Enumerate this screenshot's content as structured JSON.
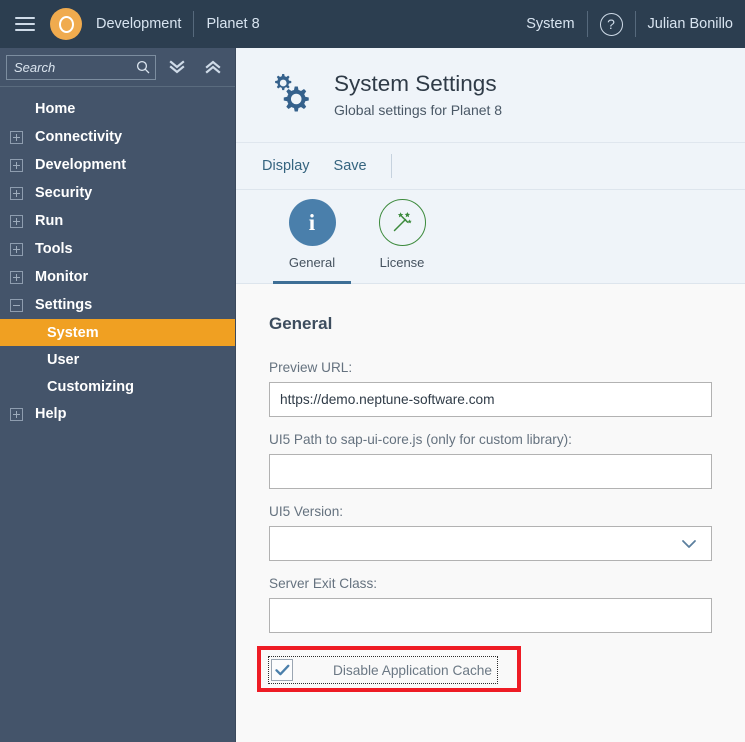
{
  "topbar": {
    "menu_icon": "hamburger-icon",
    "logo_icon": "neptune-logo-icon",
    "brand": "Development",
    "project": "Planet 8",
    "system_label": "System",
    "help_icon": "question-mark-icon",
    "user_name": "Julian Bonillo"
  },
  "sidebar": {
    "search": {
      "placeholder": "Search",
      "value": "",
      "icon": "search-icon"
    },
    "collapse_all_icon": "double-chevron-down-icon",
    "expand_all_icon": "double-chevron-up-icon",
    "items": [
      {
        "label": "Home",
        "twisty": "none"
      },
      {
        "label": "Connectivity",
        "twisty": "plus"
      },
      {
        "label": "Development",
        "twisty": "plus"
      },
      {
        "label": "Security",
        "twisty": "plus"
      },
      {
        "label": "Run",
        "twisty": "plus"
      },
      {
        "label": "Tools",
        "twisty": "plus"
      },
      {
        "label": "Monitor",
        "twisty": "plus"
      },
      {
        "label": "Settings",
        "twisty": "minus"
      }
    ],
    "settings_children": [
      {
        "label": "System",
        "active": true
      },
      {
        "label": "User",
        "active": false
      },
      {
        "label": "Customizing",
        "active": false
      }
    ],
    "help_item": {
      "label": "Help",
      "twisty": "plus"
    }
  },
  "page": {
    "icon": "gears-icon",
    "title": "System Settings",
    "subtitle": "Global settings for Planet 8"
  },
  "actions": {
    "display": "Display",
    "save": "Save"
  },
  "tabs": [
    {
      "label": "General",
      "icon": "info-icon",
      "active": true
    },
    {
      "label": "License",
      "icon": "magic-wand-icon",
      "active": false
    }
  ],
  "form": {
    "section_title": "General",
    "fields": [
      {
        "label": "Preview URL:",
        "value": "https://demo.neptune-software.com",
        "placeholder": "",
        "type": "text"
      },
      {
        "label": "UI5 Path to sap-ui-core.js (only for custom library):",
        "value": "",
        "placeholder": "",
        "type": "text"
      },
      {
        "label": "UI5 Version:",
        "value": "",
        "placeholder": "",
        "type": "select"
      },
      {
        "label": "Server Exit Class:",
        "value": "",
        "placeholder": "",
        "type": "text"
      }
    ],
    "checkbox": {
      "label": "Disable Application Cache",
      "checked": true,
      "highlighted": true
    }
  },
  "colors": {
    "topbar_bg": "#2c3e50",
    "sidebar_bg": "#44546a",
    "accent_orange": "#f0a022",
    "highlight_red": "#ee1c25",
    "tab_blue": "#4a7fab",
    "license_green": "#3c8a3c",
    "header_bg": "#eff4f9"
  }
}
